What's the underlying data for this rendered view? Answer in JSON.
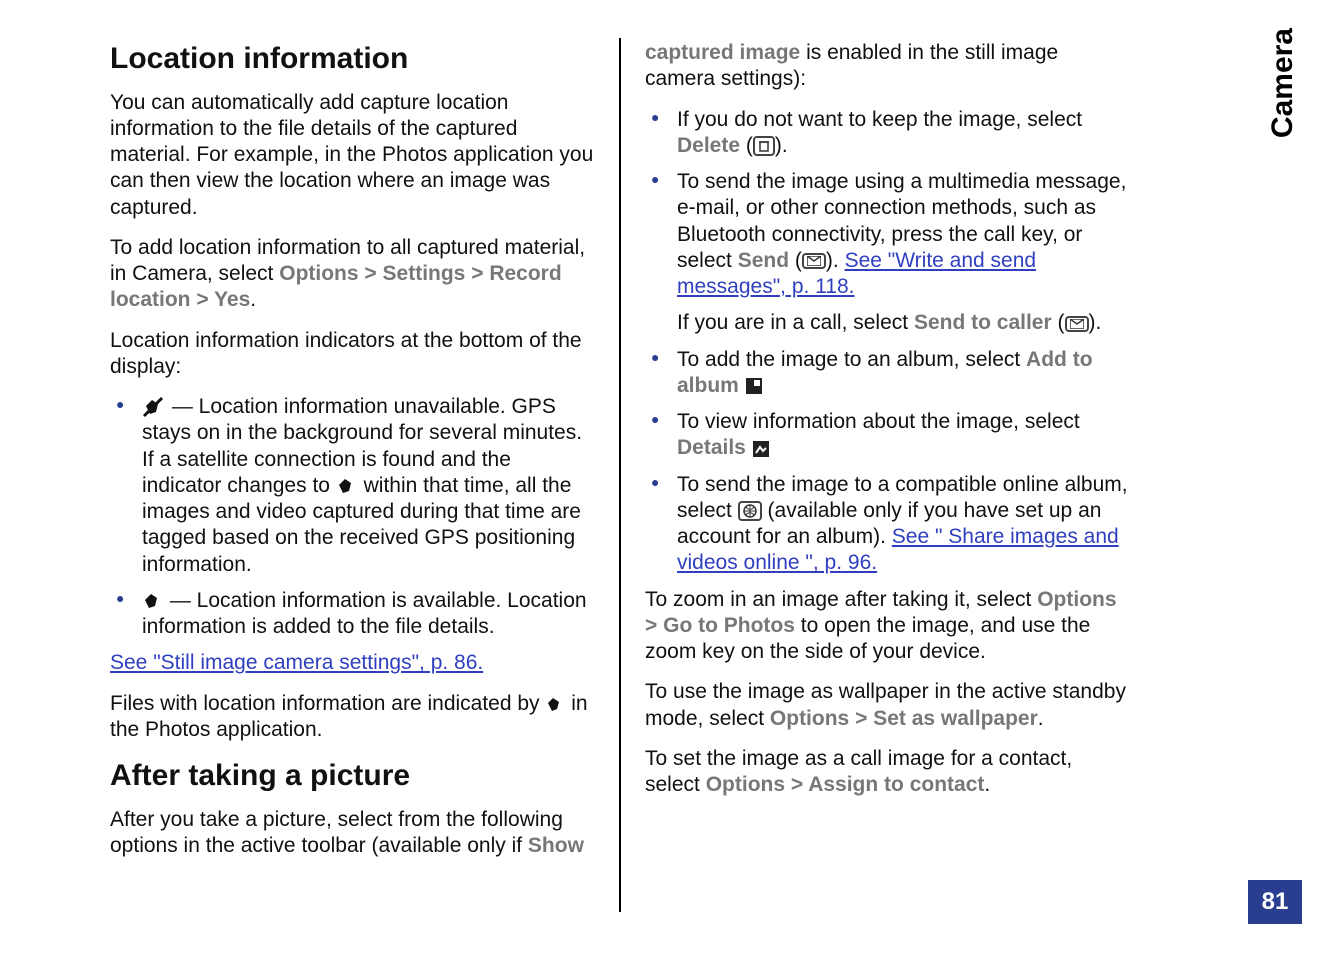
{
  "side": {
    "section": "Camera",
    "page": "81"
  },
  "left": {
    "h_loc": "Location information",
    "p1": "You can automatically add capture location information to the file details of the captured material. For example, in the Photos application you can then view the location where an image was captured.",
    "p2a": "To add location information to all captured material, in Camera, select ",
    "opt": "Options",
    "set": "Settings",
    "rec": "Record location",
    "yes": "Yes",
    "p3": "Location information indicators at the bottom of the display:",
    "li1a": " — Location information unavailable. GPS stays on in the background for several minutes. If a satellite connection is found and the indicator changes to ",
    "li1b": " within that time, all the images and video captured during that time are tagged based on the received GPS positioning information.",
    "li2": " — Location information is available. Location information is added to the file details.",
    "link1": "See \"Still image camera settings\", p. 86.",
    "p4a": "Files with location information are indicated by ",
    "p4b": " in the Photos application.",
    "h_after": "After taking a picture",
    "p5a": "After you take a picture, select from the following options in the active toolbar (available only if ",
    "show": "Show"
  },
  "right": {
    "p1a": "captured image",
    "p1b": " is enabled in the still image camera settings):",
    "li1a": "If you do not want to keep the image, select ",
    "del": "Delete",
    "li1c": " (",
    "li1d": ").",
    "li2a": "To send the image using a multimedia message, e-mail, or other connection methods, such as Bluetooth connectivity, press the call key, or select ",
    "send": "Send",
    "li2b": " (",
    "li2c": "). ",
    "link_send": "See \"Write and send messages\", p. 118.",
    "li2d": "If you are in a call, select ",
    "stc": "Send to caller",
    "li2e": " (",
    "li2f": ").",
    "li3a": "To add the image to an album, select ",
    "add": "Add to album",
    "li4a": "To view information about the image, select ",
    "det": "Details",
    "li5a": "To send the image to a compatible online album, select ",
    "li5b": " (available only if you have set up an account for an album). ",
    "link_share": "See \" Share images and videos online \", p. 96.",
    "p2a": "To zoom in an image after taking it, select ",
    "goto": "Go to Photos",
    "p2b": " to open the image, and use the zoom key on the side of your device.",
    "p3a": "To use the image as wallpaper in the active standby mode, select ",
    "wall": "Set as wallpaper",
    "p4a": "To set the image as a call image for a contact, select ",
    "assign": "Assign to contact"
  }
}
